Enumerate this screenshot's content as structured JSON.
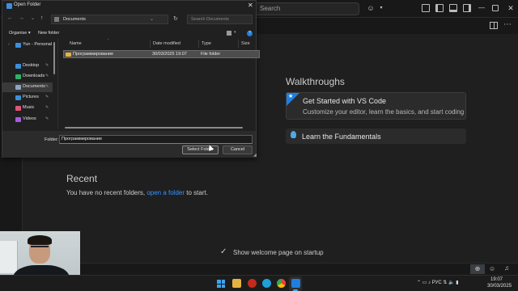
{
  "colors": {
    "vscode_bg": "#1f1f1f",
    "accent_blue": "#3794ff",
    "folder_yellow": "#e3b341",
    "dialog_bg": "#202020"
  },
  "vscode": {
    "search_placeholder": "Search",
    "welcome": {
      "walkthroughs_title": "Walkthroughs",
      "get_started_title": "Get Started with VS Code",
      "get_started_desc": "Customize your editor, learn the basics, and start coding",
      "fundamentals_label": "Learn the Fundamentals",
      "recent_title": "Recent",
      "recent_prefix": "You have no recent folders, ",
      "recent_link": "open a folder",
      "recent_suffix": " to start.",
      "show_on_startup_label": "Show welcome page on startup",
      "show_on_startup_checked": true
    }
  },
  "dialog": {
    "title": "Open Folder",
    "close_glyph": "✕",
    "path": "Documents",
    "search_placeholder": "Search Documents",
    "organise_label": "Organise ▾",
    "new_folder_label": "New folder",
    "nav_items": [
      {
        "label": "Yun - Personal",
        "icon": "onedrive-icon",
        "color": "#3c8fdb"
      },
      {
        "label": "Desktop",
        "icon": "desktop-icon",
        "color": "#3c8fdb"
      },
      {
        "label": "Downloads",
        "icon": "downloads-icon",
        "color": "#2fb06a"
      },
      {
        "label": "Documents",
        "icon": "documents-icon",
        "color": "#8aa6c1"
      },
      {
        "label": "Pictures",
        "icon": "pictures-icon",
        "color": "#3c8fdb"
      },
      {
        "label": "Music",
        "icon": "music-icon",
        "color": "#e0557a"
      },
      {
        "label": "Videos",
        "icon": "videos-icon",
        "color": "#a45ce0"
      }
    ],
    "columns": {
      "name": "Name",
      "date": "Date modified",
      "type": "Type",
      "size": "Size"
    },
    "files": [
      {
        "name": "Программирование",
        "date": "30/03/2025 19:07",
        "type": "File folder",
        "size": ""
      }
    ],
    "folder_label": "Folder:",
    "folder_value": "Программирование",
    "select_button": "Select Folder",
    "cancel_button": "Cancel"
  },
  "taskbar": {
    "tray_text": "⌃  ▭  ♪  РУС  ⇅  🔈 ▮",
    "time": "19:07",
    "date": "30/03/2025"
  }
}
